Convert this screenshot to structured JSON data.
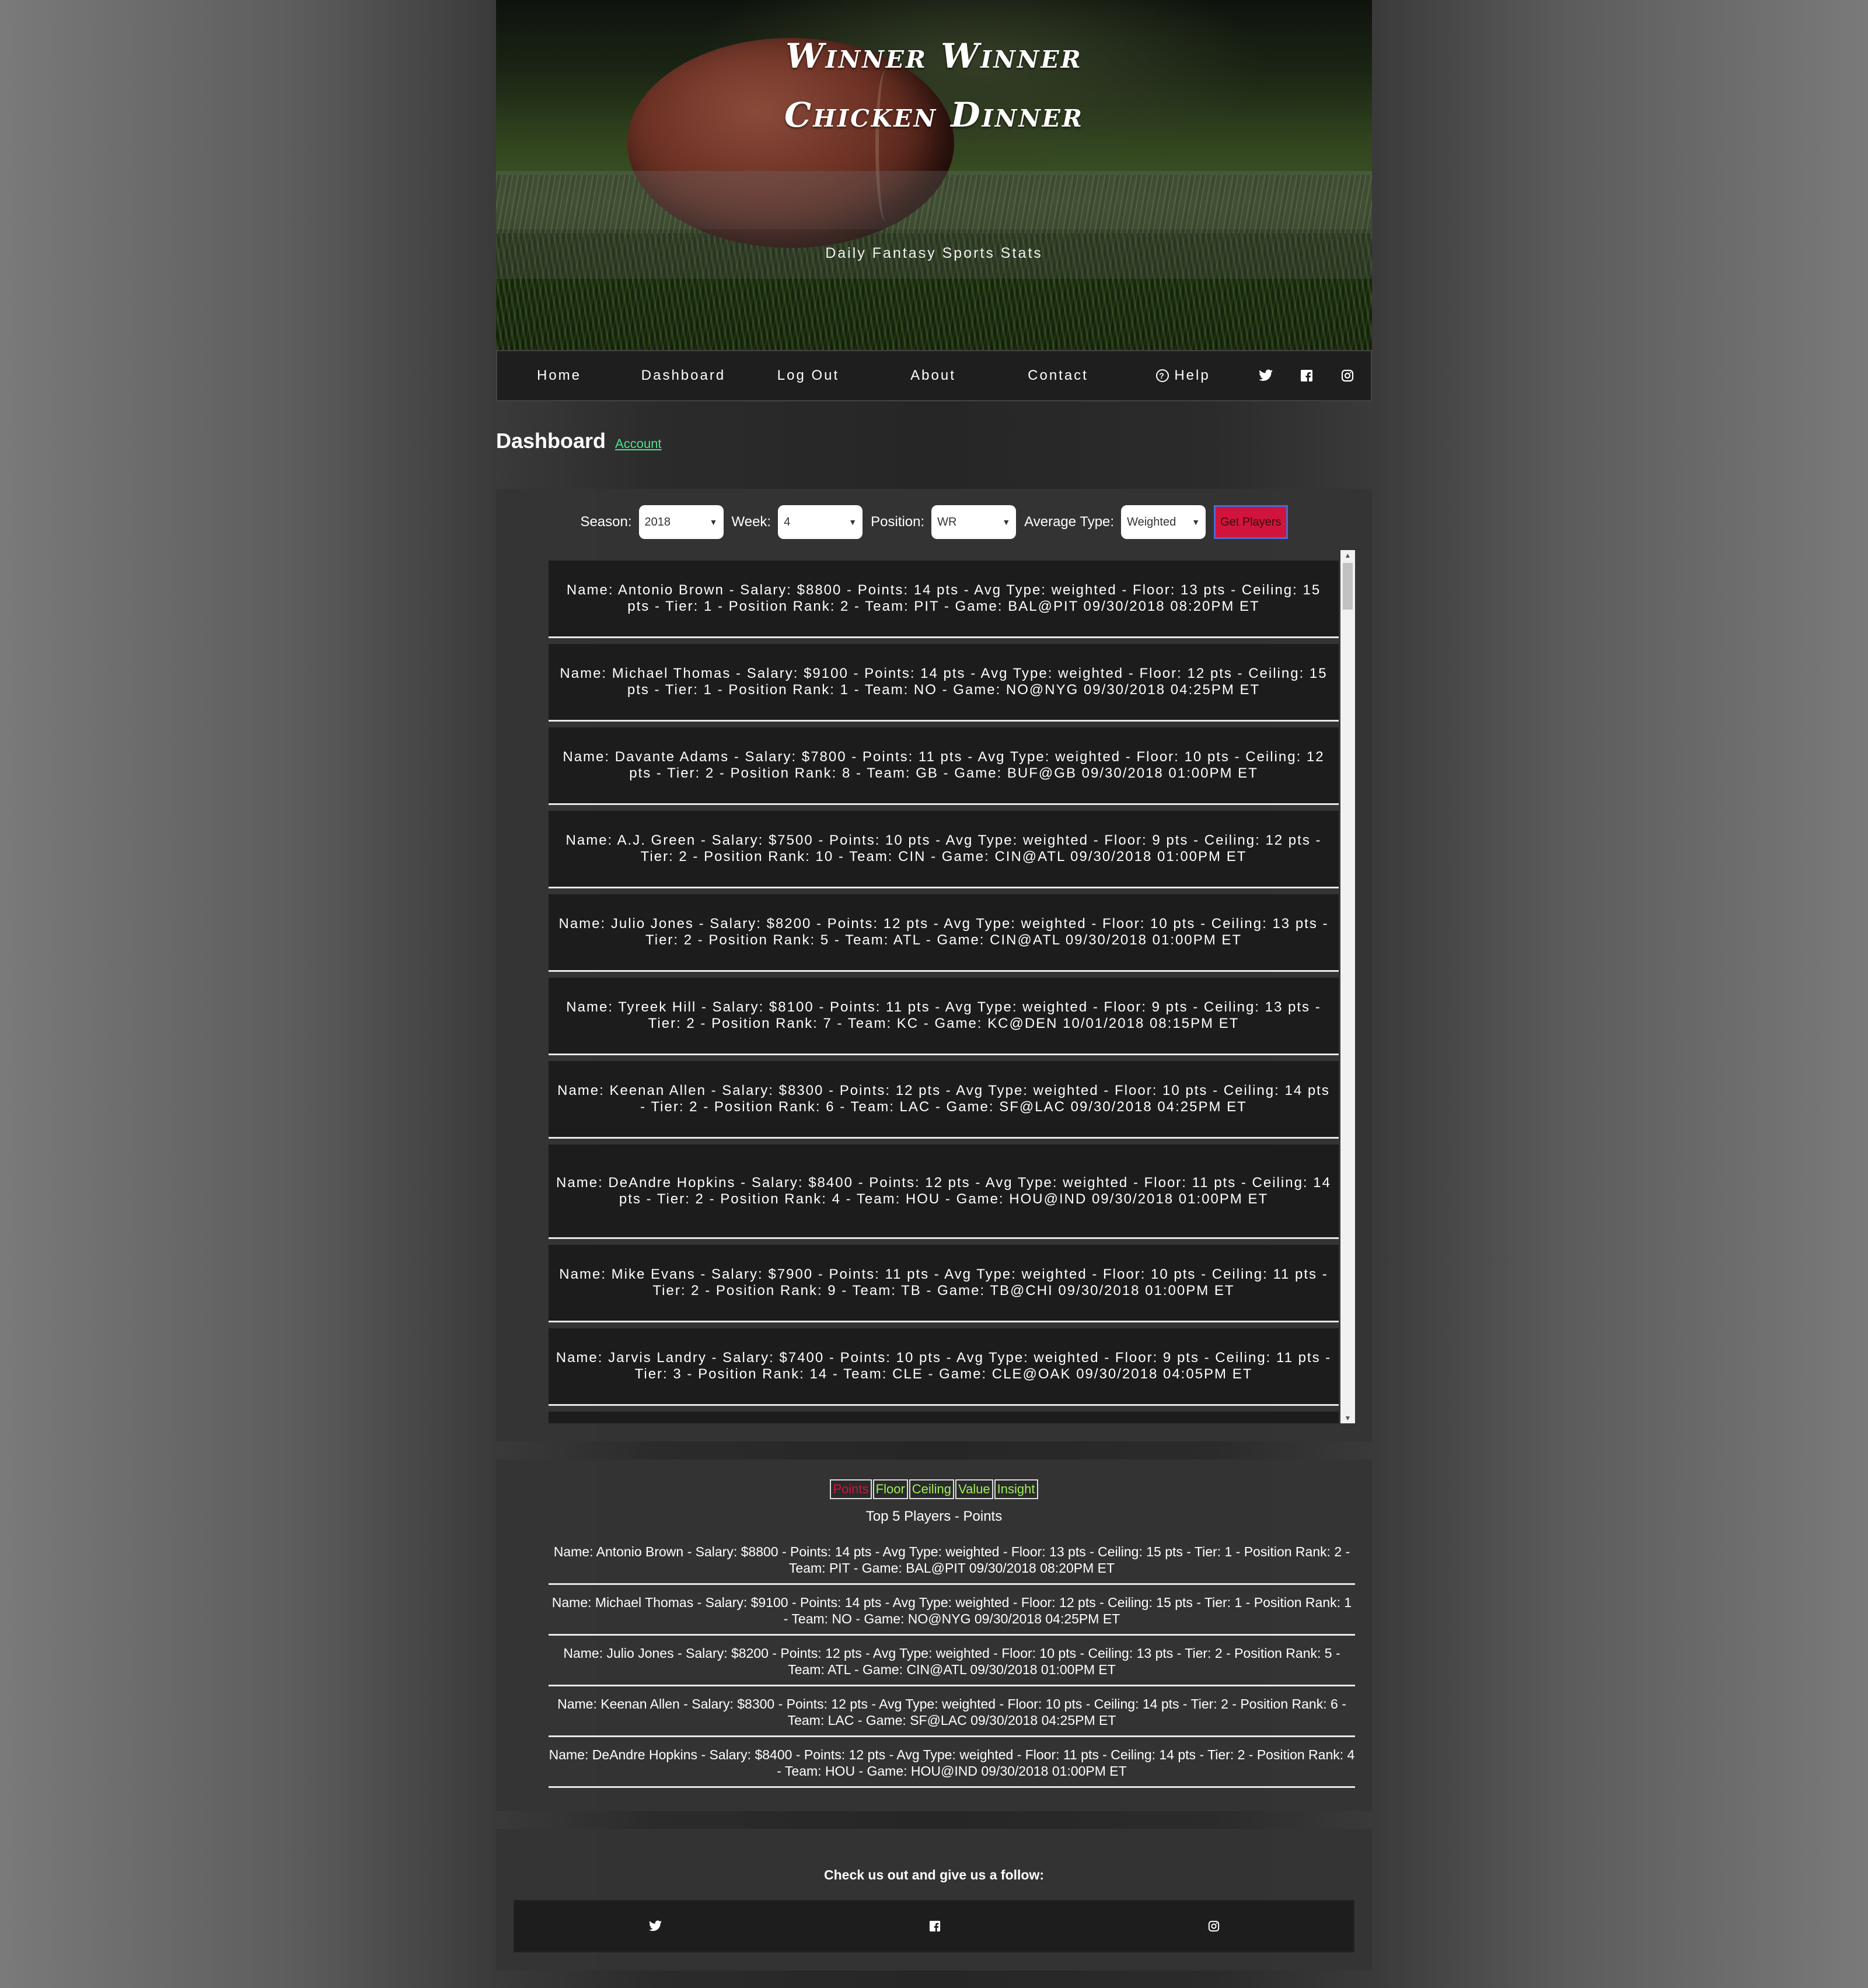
{
  "hero": {
    "title_line1": "Winner Winner",
    "title_line2": "Chicken Dinner",
    "subtitle": "Daily Fantasy Sports Stats"
  },
  "nav": {
    "home": "Home",
    "dashboard": "Dashboard",
    "logout": "Log Out",
    "about": "About",
    "contact": "Contact",
    "help": "Help",
    "icons": [
      "twitter-icon",
      "facebook-icon",
      "instagram-icon"
    ]
  },
  "dashboard": {
    "title": "Dashboard",
    "account_link": "Account"
  },
  "filters": {
    "season_label": "Season:",
    "season_value": "2018",
    "week_label": "Week:",
    "week_value": "4",
    "position_label": "Position:",
    "position_value": "WR",
    "avg_type_label": "Average Type:",
    "avg_type_value": "Weighted",
    "get_players_label": "Get Players"
  },
  "players": [
    "Name: Antonio Brown - Salary: $8800 - Points: 14 pts - Avg Type: weighted - Floor: 13 pts - Ceiling: 15 pts - Tier: 1 - Position Rank: 2 - Team: PIT - Game: BAL@PIT 09/30/2018 08:20PM ET",
    "Name: Michael Thomas - Salary: $9100 - Points: 14 pts - Avg Type: weighted - Floor: 12 pts - Ceiling: 15 pts - Tier: 1 - Position Rank: 1 - Team: NO - Game: NO@NYG 09/30/2018 04:25PM ET",
    "Name: Davante Adams - Salary: $7800 - Points: 11 pts - Avg Type: weighted - Floor: 10 pts - Ceiling: 12 pts - Tier: 2 - Position Rank: 8 - Team: GB - Game: BUF@GB 09/30/2018 01:00PM ET",
    "Name: A.J. Green - Salary: $7500 - Points: 10 pts - Avg Type: weighted - Floor: 9 pts - Ceiling: 12 pts - Tier: 2 - Position Rank: 10 - Team: CIN - Game: CIN@ATL 09/30/2018 01:00PM ET",
    "Name: Julio Jones - Salary: $8200 - Points: 12 pts - Avg Type: weighted - Floor: 10 pts - Ceiling: 13 pts - Tier: 2 - Position Rank: 5 - Team: ATL - Game: CIN@ATL 09/30/2018 01:00PM ET",
    "Name: Tyreek Hill - Salary: $8100 - Points: 11 pts - Avg Type: weighted - Floor: 9 pts - Ceiling: 13 pts - Tier: 2 - Position Rank: 7 - Team: KC - Game: KC@DEN 10/01/2018 08:15PM ET",
    "Name: Keenan Allen - Salary: $8300 - Points: 12 pts - Avg Type: weighted - Floor: 10 pts - Ceiling: 14 pts - Tier: 2 - Position Rank: 6 - Team: LAC - Game: SF@LAC 09/30/2018 04:25PM ET",
    "Name: DeAndre Hopkins - Salary: $8400 - Points: 12 pts - Avg Type: weighted - Floor: 11 pts - Ceiling: 14 pts - Tier: 2 - Position Rank: 4 - Team: HOU - Game: HOU@IND 09/30/2018 01:00PM ET",
    "Name: Mike Evans - Salary: $7900 - Points: 11 pts - Avg Type: weighted - Floor: 10 pts - Ceiling: 11 pts - Tier: 2 - Position Rank: 9 - Team: TB - Game: TB@CHI 09/30/2018 01:00PM ET",
    "Name: Jarvis Landry - Salary: $7400 - Points: 10 pts - Avg Type: weighted - Floor: 9 pts - Ceiling: 11 pts - Tier: 3 - Position Rank: 14 - Team: CLE - Game: CLE@OAK 09/30/2018 04:05PM ET"
  ],
  "tabs": [
    "Points",
    "Floor",
    "Ceiling",
    "Value",
    "Insight"
  ],
  "top5": {
    "title": "Top 5 Players - Points",
    "items": [
      "Name: Antonio Brown - Salary: $8800 - Points: 14 pts - Avg Type: weighted - Floor: 13 pts - Ceiling: 15 pts - Tier: 1 - Position Rank: 2 - Team: PIT - Game: BAL@PIT 09/30/2018 08:20PM ET",
      "Name: Michael Thomas - Salary: $9100 - Points: 14 pts - Avg Type: weighted - Floor: 12 pts - Ceiling: 15 pts - Tier: 1 - Position Rank: 1 - Team: NO - Game: NO@NYG 09/30/2018 04:25PM ET",
      "Name: Julio Jones - Salary: $8200 - Points: 12 pts - Avg Type: weighted - Floor: 10 pts - Ceiling: 13 pts - Tier: 2 - Position Rank: 5 - Team: ATL - Game: CIN@ATL 09/30/2018 01:00PM ET",
      "Name: Keenan Allen - Salary: $8300 - Points: 12 pts - Avg Type: weighted - Floor: 10 pts - Ceiling: 14 pts - Tier: 2 - Position Rank: 6 - Team: LAC - Game: SF@LAC 09/30/2018 04:25PM ET",
      "Name: DeAndre Hopkins - Salary: $8400 - Points: 12 pts - Avg Type: weighted - Floor: 11 pts - Ceiling: 14 pts - Tier: 2 - Position Rank: 4 - Team: HOU - Game: HOU@IND 09/30/2018 01:00PM ET"
    ]
  },
  "footer": {
    "follow_text": "Check us out and give us a follow:",
    "icons": [
      "twitter-icon",
      "facebook-icon",
      "instagram-icon"
    ]
  },
  "colors": {
    "accent_red": "#d1143c",
    "link_green": "#4ee08c",
    "tab_green": "#9ef05a"
  }
}
